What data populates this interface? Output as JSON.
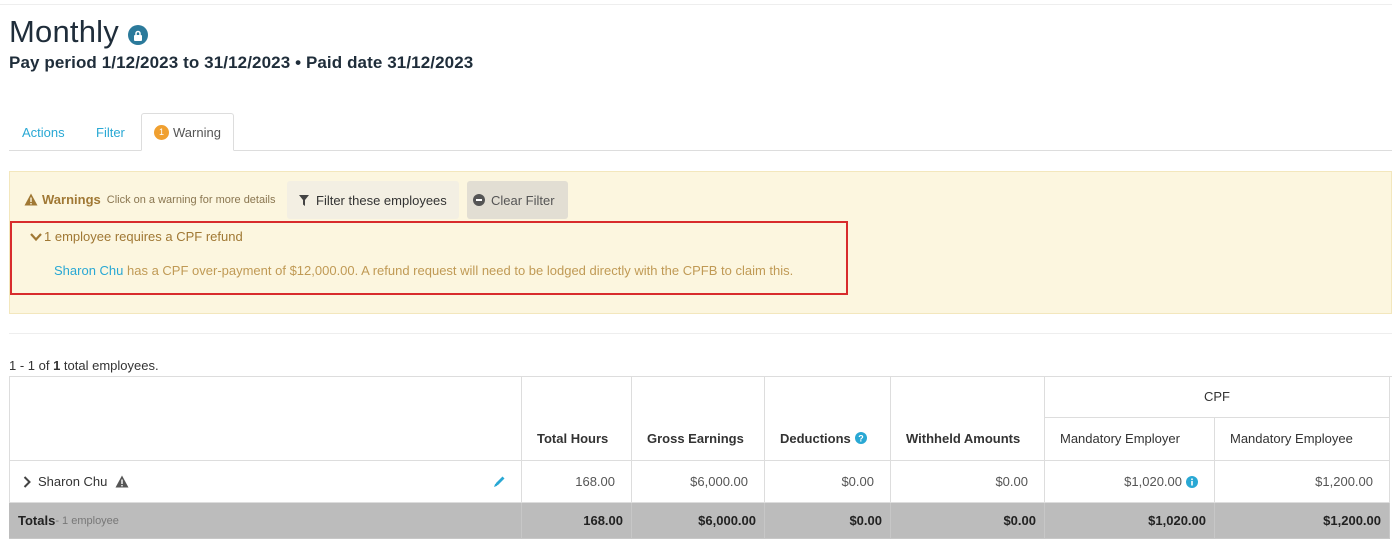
{
  "page": {
    "title": "Monthly",
    "subtitle": "Pay period 1/12/2023 to 31/12/2023 • Paid date 31/12/2023"
  },
  "tabs": [
    {
      "label": "Actions"
    },
    {
      "label": "Filter"
    },
    {
      "label": "Warning",
      "badge": "1"
    }
  ],
  "warnings": {
    "heading": "Warnings",
    "hint": "Click on a warning for more details",
    "filter_button": "Filter these employees",
    "clear_button": "Clear Filter",
    "item_title": "1 employee requires a CPF refund",
    "item_employee": "Sharon Chu",
    "item_text": " has a CPF over-payment of $12,000.00. A refund request will need to be lodged directly with the CPFB to claim this."
  },
  "table": {
    "count_prefix": "1 - 1 of ",
    "count_total": "1",
    "count_suffix": " total employees.",
    "group_header": "CPF",
    "columns": [
      "Total Hours",
      "Gross Earnings",
      "Deductions",
      "Withheld Amounts",
      "Mandatory Employer",
      "Mandatory Employee"
    ],
    "row": {
      "name": "Sharon Chu",
      "values": [
        "168.00",
        "$6,000.00",
        "$0.00",
        "$0.00",
        "$1,020.00",
        "$1,200.00"
      ]
    },
    "totals": {
      "label": "Totals",
      "sub": " - 1 employee",
      "values": [
        "168.00",
        "$6,000.00",
        "$0.00",
        "$0.00",
        "$1,020.00",
        "$1,200.00"
      ]
    }
  },
  "colors": {
    "accent": "#29a8d4",
    "warning_bg": "#fcf6df",
    "warning_text": "#a07834",
    "highlight_border": "#d82c2c",
    "badge": "#f0a030",
    "totals_bg": "#bcbcbc"
  },
  "icons": {
    "lock": "lock-icon",
    "warning": "warning-triangle-icon",
    "filter": "funnel-icon",
    "clear": "minus-circle-icon",
    "expand": "chevron-down-icon",
    "row_expand": "chevron-right-icon",
    "edit": "pencil-icon",
    "help": "question-circle-icon",
    "info": "info-circle-icon"
  }
}
